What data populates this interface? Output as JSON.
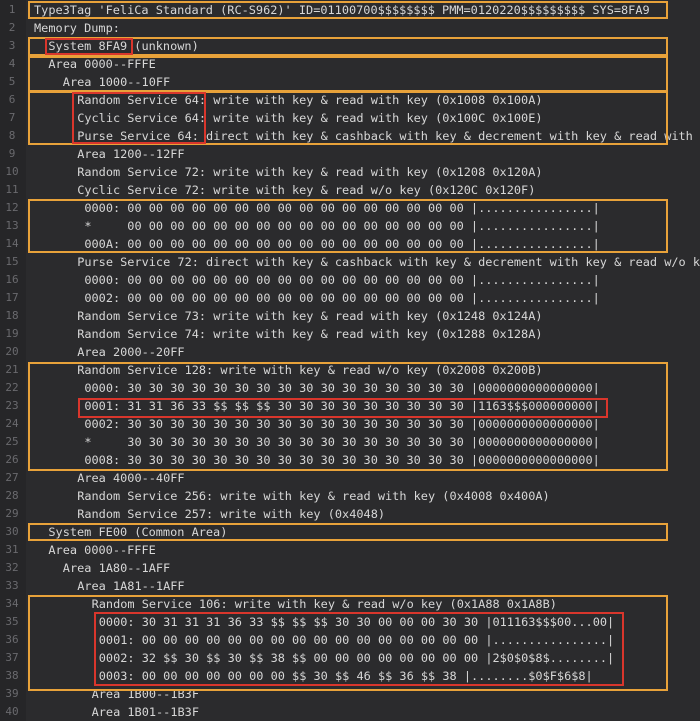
{
  "lines": [
    {
      "n": "1",
      "indent": 0,
      "text": "Type3Tag 'FeliCa Standard (RC-S962)' ID=01100700$$$$$$$$ PMM=0120220$$$$$$$$$ SYS=8FA9"
    },
    {
      "n": "2",
      "indent": 0,
      "text": "Memory Dump:"
    },
    {
      "n": "3",
      "indent": 1,
      "text": "System 8FA9 (unknown)"
    },
    {
      "n": "4",
      "indent": 1,
      "text": "Area 0000--FFFE"
    },
    {
      "n": "5",
      "indent": 2,
      "text": "Area 1000--10FF"
    },
    {
      "n": "6",
      "indent": 3,
      "text": "Random Service 64: write with key & read with key (0x1008 0x100A)"
    },
    {
      "n": "7",
      "indent": 3,
      "text": "Cyclic Service 64: write with key & read with key (0x100C 0x100E)"
    },
    {
      "n": "8",
      "indent": 3,
      "text": "Purse Service 64: direct with key & cashback with key & decrement with key & read with"
    },
    {
      "n": "9",
      "indent": 3,
      "text": "Area 1200--12FF"
    },
    {
      "n": "10",
      "indent": 3,
      "text": "Random Service 72: write with key & read with key (0x1208 0x120A)"
    },
    {
      "n": "11",
      "indent": 3,
      "text": "Cyclic Service 72: write with key & read w/o key (0x120C 0x120F)"
    },
    {
      "n": "12",
      "indent": 3,
      "text": " 0000: 00 00 00 00 00 00 00 00 00 00 00 00 00 00 00 00 |................|"
    },
    {
      "n": "13",
      "indent": 3,
      "text": " *     00 00 00 00 00 00 00 00 00 00 00 00 00 00 00 00 |................|"
    },
    {
      "n": "14",
      "indent": 3,
      "text": " 000A: 00 00 00 00 00 00 00 00 00 00 00 00 00 00 00 00 |................|"
    },
    {
      "n": "15",
      "indent": 3,
      "text": "Purse Service 72: direct with key & cashback with key & decrement with key & read w/o k"
    },
    {
      "n": "16",
      "indent": 3,
      "text": " 0000: 00 00 00 00 00 00 00 00 00 00 00 00 00 00 00 00 |................|"
    },
    {
      "n": "17",
      "indent": 3,
      "text": " 0002: 00 00 00 00 00 00 00 00 00 00 00 00 00 00 00 00 |................|"
    },
    {
      "n": "18",
      "indent": 3,
      "text": "Random Service 73: write with key & read with key (0x1248 0x124A)"
    },
    {
      "n": "19",
      "indent": 3,
      "text": "Random Service 74: write with key & read with key (0x1288 0x128A)"
    },
    {
      "n": "20",
      "indent": 3,
      "text": "Area 2000--20FF"
    },
    {
      "n": "21",
      "indent": 3,
      "text": "Random Service 128: write with key & read w/o key (0x2008 0x200B)"
    },
    {
      "n": "22",
      "indent": 3,
      "text": " 0000: 30 30 30 30 30 30 30 30 30 30 30 30 30 30 30 30 |0000000000000000|"
    },
    {
      "n": "23",
      "indent": 3,
      "text": " 0001: 31 31 36 33 $$ $$ $$ 30 30 30 30 30 30 30 30 30 |1163$$$000000000|"
    },
    {
      "n": "24",
      "indent": 3,
      "text": " 0002: 30 30 30 30 30 30 30 30 30 30 30 30 30 30 30 30 |0000000000000000|"
    },
    {
      "n": "25",
      "indent": 3,
      "text": " *     30 30 30 30 30 30 30 30 30 30 30 30 30 30 30 30 |0000000000000000|"
    },
    {
      "n": "26",
      "indent": 3,
      "text": " 0008: 30 30 30 30 30 30 30 30 30 30 30 30 30 30 30 30 |0000000000000000|"
    },
    {
      "n": "27",
      "indent": 3,
      "text": "Area 4000--40FF"
    },
    {
      "n": "28",
      "indent": 3,
      "text": "Random Service 256: write with key & read with key (0x4008 0x400A)"
    },
    {
      "n": "29",
      "indent": 3,
      "text": "Random Service 257: write with key (0x4048)"
    },
    {
      "n": "30",
      "indent": 1,
      "text": "System FE00 (Common Area)"
    },
    {
      "n": "31",
      "indent": 1,
      "text": "Area 0000--FFFE"
    },
    {
      "n": "32",
      "indent": 2,
      "text": "Area 1A80--1AFF"
    },
    {
      "n": "33",
      "indent": 3,
      "text": "Area 1A81--1AFF"
    },
    {
      "n": "34",
      "indent": 4,
      "text": "Random Service 106: write with key & read w/o key (0x1A88 0x1A8B)"
    },
    {
      "n": "35",
      "indent": 4,
      "text": " 0000: 30 31 31 31 36 33 $$ $$ $$ 30 30 00 00 00 30 30 |011163$$$00...00|"
    },
    {
      "n": "36",
      "indent": 4,
      "text": " 0001: 00 00 00 00 00 00 00 00 00 00 00 00 00 00 00 00 |................|"
    },
    {
      "n": "37",
      "indent": 4,
      "text": " 0002: 32 $$ 30 $$ 30 $$ 38 $$ 00 00 00 00 00 00 00 00 |2$0$0$8$........|"
    },
    {
      "n": "38",
      "indent": 4,
      "text": " 0003: 00 00 00 00 00 00 00 $$ 30 $$ 46 $$ 36 $$ 38 |........$0$F$6$8|"
    },
    {
      "n": "39",
      "indent": 4,
      "text": "Area 1B00--1B3F"
    },
    {
      "n": "40",
      "indent": 4,
      "text": "Area 1B01--1B3F"
    }
  ]
}
